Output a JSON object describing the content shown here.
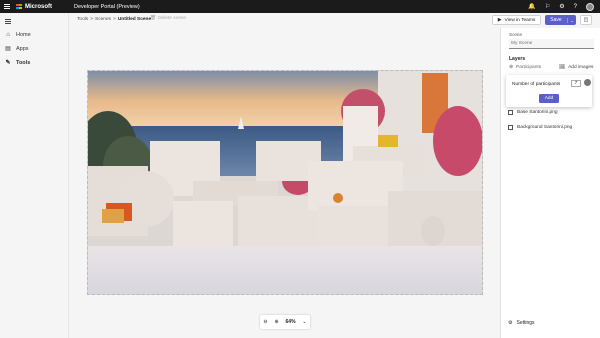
{
  "topbar": {
    "brand": "Microsoft",
    "app_title": "Developer Portal (Preview)",
    "icons": [
      "bell-icon",
      "flag-icon",
      "gear-icon",
      "help-icon",
      "avatar"
    ]
  },
  "nav": {
    "items": [
      {
        "label": "Home",
        "icon": "home-icon"
      },
      {
        "label": "Apps",
        "icon": "apps-icon"
      },
      {
        "label": "Tools",
        "icon": "tools-icon"
      }
    ]
  },
  "breadcrumb": {
    "items": [
      "Tools",
      "Scenes",
      "Untitled Scene"
    ],
    "sep": ">"
  },
  "toolbar": {
    "delete_label": "Delete scene",
    "view_teams_label": "View in Teams",
    "save_label": "Save"
  },
  "zoom": {
    "value": "64%"
  },
  "panel": {
    "scene_label": "Scene",
    "scene_placeholder": "My Scene",
    "layers_title": "Layers",
    "participants_label": "Participants",
    "add_images_label": "Add images",
    "popup": {
      "num_label": "Number of participants",
      "num_value": "7",
      "add_label": "Add"
    },
    "layers": [
      {
        "name": "Base Santorini.png"
      },
      {
        "name": "Background Santorini.png"
      }
    ],
    "settings_label": "Settings"
  },
  "colors": {
    "accent": "#5b5fc7",
    "topbar": "#1b1b1b"
  }
}
